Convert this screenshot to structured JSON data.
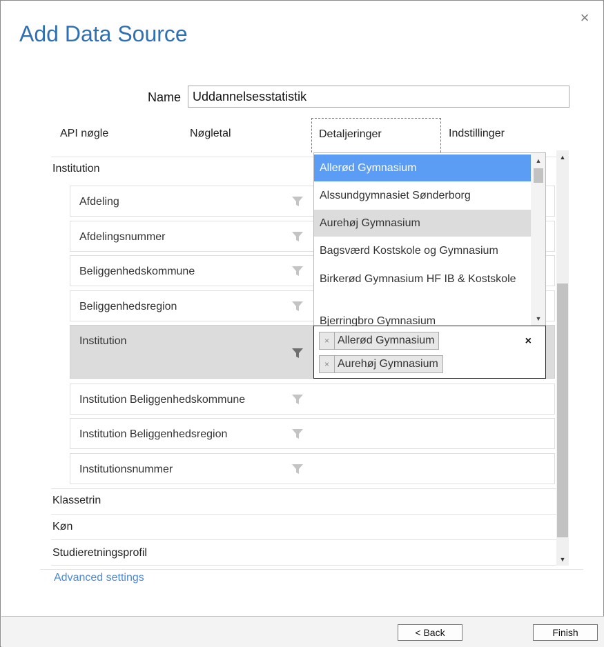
{
  "dialog": {
    "title": "Add Data Source",
    "close_symbol": "×"
  },
  "name_field": {
    "label": "Name",
    "value": "Uddannelsesstatistik"
  },
  "tabs": [
    {
      "label": "API nøgle"
    },
    {
      "label": "Nøgletal"
    },
    {
      "label": "Detaljeringer",
      "active": true
    },
    {
      "label": "Indstillinger"
    }
  ],
  "groups": {
    "institution": "Institution",
    "klassetrin": "Klassetrin",
    "kon": "Køn",
    "studieretningsprofil": "Studieretningsprofil"
  },
  "fields": [
    {
      "label": "Afdeling"
    },
    {
      "label": "Afdelingsnummer"
    },
    {
      "label": "Beliggenhedskommune"
    },
    {
      "label": "Beliggenhedsregion"
    },
    {
      "label": "Institution",
      "selected": true
    },
    {
      "label": "Institution Beliggenhedskommune"
    },
    {
      "label": "Institution Beliggenhedsregion"
    },
    {
      "label": "Institutionsnummer"
    }
  ],
  "dropdown": {
    "options": [
      {
        "label": "Allerød Gymnasium",
        "state": "highlighted"
      },
      {
        "label": "Alssundgymnasiet Sønderborg",
        "state": ""
      },
      {
        "label": "Aurehøj Gymnasium",
        "state": "selected"
      },
      {
        "label": "Bagsværd Kostskole og Gymnasium",
        "state": ""
      },
      {
        "label": "Birkerød Gymnasium HF IB & Kostskole",
        "state": ""
      },
      {
        "label": "Bjerringbro Gymnasium",
        "state": ""
      }
    ]
  },
  "multiselect": {
    "tags": [
      "Allerød Gymnasium",
      "Aurehøj Gymnasium"
    ],
    "remove_symbol": "×",
    "clear_symbol": "×"
  },
  "advanced_settings": "Advanced settings",
  "buttons": {
    "back": "< Back",
    "finish": "Finish"
  },
  "colors": {
    "title": "#2f6fb3",
    "highlight": "#5b9cf5",
    "link": "#4a89d8",
    "selected_row": "#dcdcdc"
  }
}
